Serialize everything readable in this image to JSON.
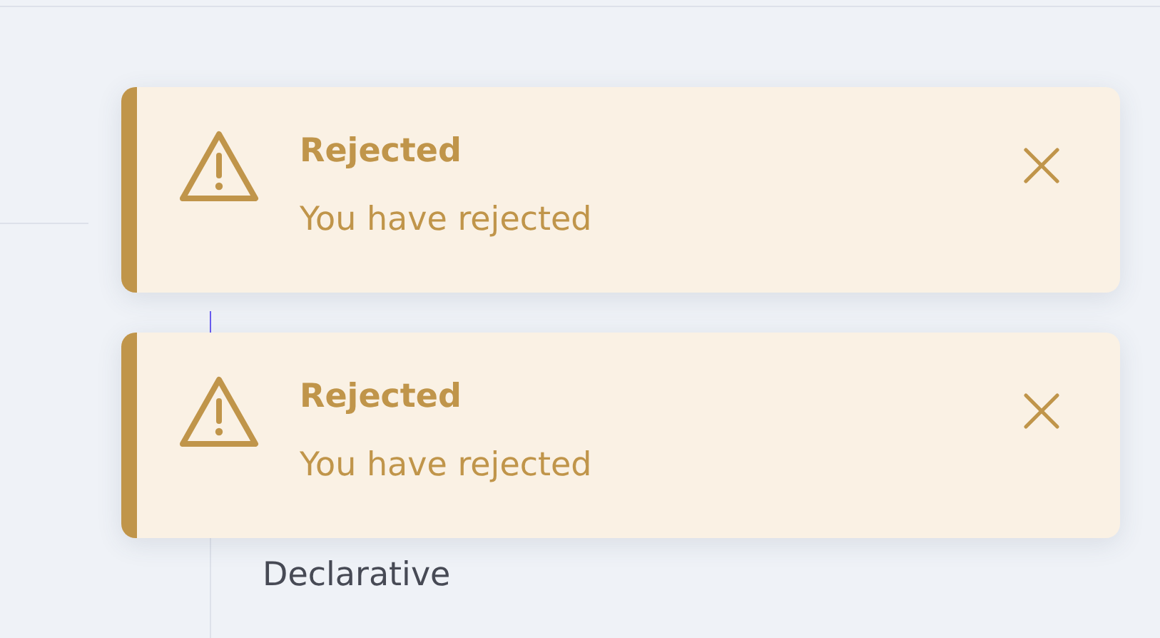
{
  "nav": {
    "items": [
      {
        "label": "Declarative"
      }
    ]
  },
  "toasts": [
    {
      "kind": "warning",
      "title": "Rejected",
      "message": "You have rejected"
    },
    {
      "kind": "warning",
      "title": "Rejected",
      "message": "You have rejected"
    }
  ]
}
